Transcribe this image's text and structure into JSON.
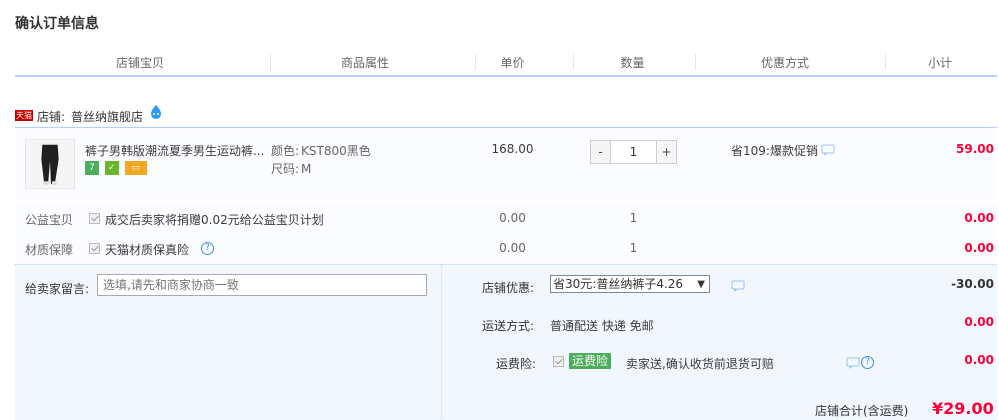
{
  "page": {
    "title": "确认订单信息"
  },
  "columns": [
    "店铺宝贝",
    "商品属性",
    "单价",
    "数量",
    "优惠方式",
    "小计"
  ],
  "shop": {
    "badge": "天猫",
    "label": "店铺:",
    "name": "普丝纳旗舰店"
  },
  "item": {
    "title": "裤子男韩版潮流夏季男生运动裤...",
    "attrs": [
      {
        "key": "颜色:",
        "value": "KST800黑色"
      },
      {
        "key": "尺码:",
        "value": "M"
      }
    ],
    "price": "168.00",
    "quantity": "1",
    "qty_minus": "-",
    "qty_plus": "+",
    "promo": "省109:爆款促销",
    "subtotal": "59.00",
    "icons": [
      "seven-day-return-icon",
      "guarantee-icon",
      "credit-card-icon"
    ]
  },
  "extras": [
    {
      "label": "公益宝贝",
      "text": "成交后卖家将捐赠0.02元给公益宝贝计划",
      "price": "0.00",
      "qty": "1",
      "subtotal": "0.00",
      "checked": true
    },
    {
      "label": "材质保障",
      "text": "天猫材质保真险",
      "price": "0.00",
      "qty": "1",
      "subtotal": "0.00",
      "checked": true
    }
  ],
  "memo": {
    "label": "给卖家留言:",
    "placeholder": "选填,请先和商家协商一致"
  },
  "discount": {
    "label": "店铺优惠:",
    "selected": "省30元:普丝纳裤子4.26",
    "amount": "-30.00"
  },
  "shipping": {
    "label": "运送方式:",
    "value": "普通配送 快递 免邮",
    "amount": "0.00"
  },
  "freight_insurance": {
    "label": "运费险:",
    "tag": "运费险",
    "text": "卖家送,确认收货前退货可赔",
    "amount": "0.00",
    "checked": true
  },
  "total": {
    "label": "店铺合计(含运费)",
    "value": "¥29.00"
  },
  "colors": {
    "accent_red": "#ff0036",
    "border_blue": "#b2d1ff",
    "panel_bg": "#f2f7ff",
    "tmall_red": "#c40000",
    "green": "#4bae5b"
  }
}
